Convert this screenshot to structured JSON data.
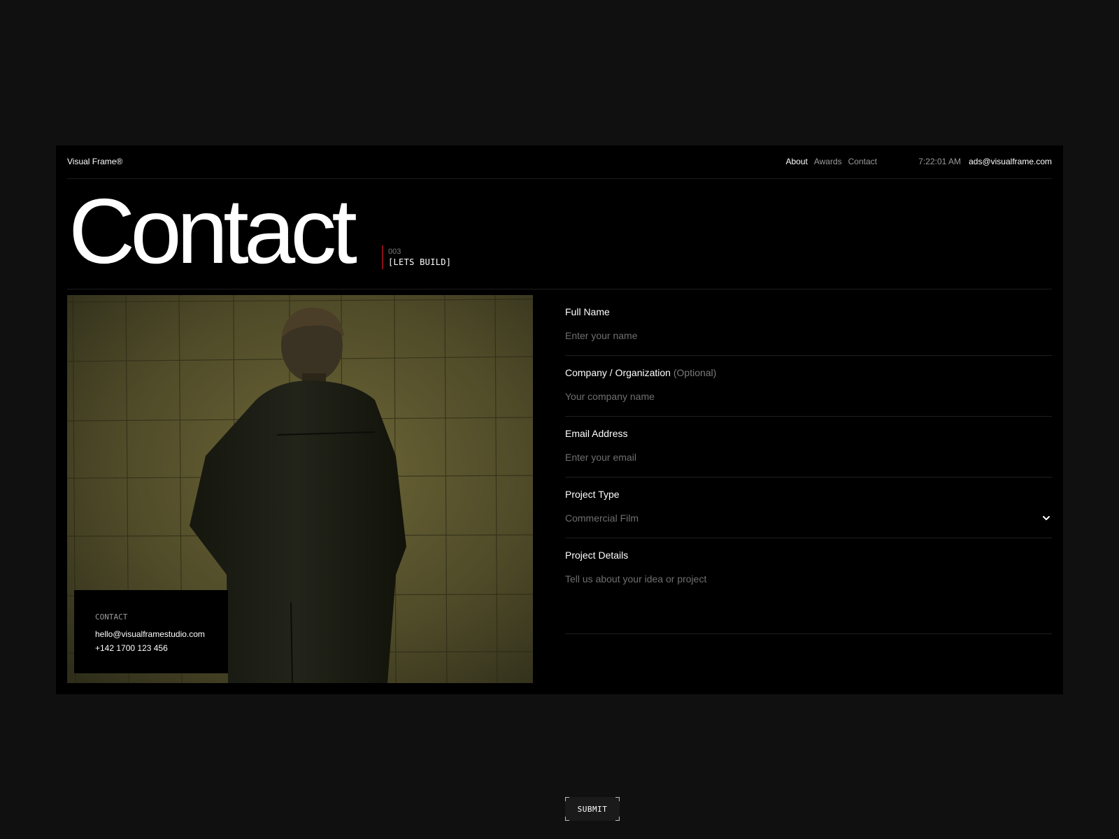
{
  "header": {
    "brand": "Visual Frame®",
    "nav": [
      {
        "label": "About",
        "active": true
      },
      {
        "label": "Awards",
        "active": false
      },
      {
        "label": "Contact",
        "active": false
      }
    ],
    "time": "7:22:01 AM",
    "email": "ads@visualframe.com"
  },
  "hero": {
    "title": "Contact",
    "number": "003",
    "label": "[LETS BUILD]"
  },
  "contact_card": {
    "title": "CONTACT",
    "email": "hello@visualframestudio.com",
    "phone": "+142 1700 123 456"
  },
  "form": {
    "full_name": {
      "label": "Full Name",
      "placeholder": "Enter your name"
    },
    "company": {
      "label": "Company / Organization",
      "optional": "(Optional)",
      "placeholder": "Your company name"
    },
    "email": {
      "label": "Email Address",
      "placeholder": "Enter your email"
    },
    "project_type": {
      "label": "Project Type",
      "value": "Commercial Film"
    },
    "details": {
      "label": "Project Details",
      "placeholder": "Tell us about your idea or project"
    },
    "submit_label": "SUBMIT"
  },
  "colors": {
    "background": "#101010",
    "panel": "#000000",
    "accent": "#8a0f1a",
    "muted": "#9a9a9a"
  }
}
